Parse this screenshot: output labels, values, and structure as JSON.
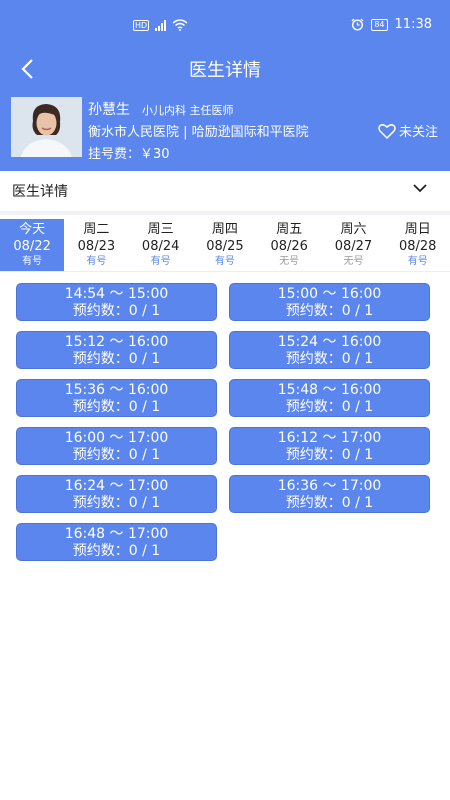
{
  "status": {
    "time": "11:38",
    "hd": "HD",
    "network": "4G",
    "battery": "84"
  },
  "nav": {
    "title": "医生详情"
  },
  "doctor": {
    "name": "孙慧生",
    "dept": "小儿内科 主任医师",
    "hospital": "衡水市人民医院 | 哈励逊国际和平医院",
    "fee": "挂号费：￥30",
    "follow_label": "未关注"
  },
  "section": {
    "title": "医生详情"
  },
  "days": [
    {
      "week": "今天",
      "date": "08/22",
      "status": "有号"
    },
    {
      "week": "周二",
      "date": "08/23",
      "status": "有号"
    },
    {
      "week": "周三",
      "date": "08/24",
      "status": "有号"
    },
    {
      "week": "周四",
      "date": "08/25",
      "status": "有号"
    },
    {
      "week": "周五",
      "date": "08/26",
      "status": "无号"
    },
    {
      "week": "周六",
      "date": "08/27",
      "status": "无号"
    },
    {
      "week": "周日",
      "date": "08/28",
      "status": "有号"
    }
  ],
  "slots": [
    {
      "time": "14:54 ～ 15:00",
      "count": "预约数：0 / 1"
    },
    {
      "time": "15:00 ～ 16:00",
      "count": "预约数：0 / 1"
    },
    {
      "time": "15:12 ～ 16:00",
      "count": "预约数：0 / 1"
    },
    {
      "time": "15:24 ～ 16:00",
      "count": "预约数：0 / 1"
    },
    {
      "time": "15:36 ～ 16:00",
      "count": "预约数：0 / 1"
    },
    {
      "time": "15:48 ～ 16:00",
      "count": "预约数：0 / 1"
    },
    {
      "time": "16:00 ～ 17:00",
      "count": "预约数：0 / 1"
    },
    {
      "time": "16:12 ～ 17:00",
      "count": "预约数：0 / 1"
    },
    {
      "time": "16:24 ～ 17:00",
      "count": "预约数：0 / 1"
    },
    {
      "time": "16:36 ～ 17:00",
      "count": "预约数：0 / 1"
    },
    {
      "time": "16:48 ～ 17:00",
      "count": "预约数：0 / 1"
    }
  ],
  "colors": {
    "primary": "#5a86ee",
    "available": "#5a86ee",
    "unavailable": "#999999"
  }
}
